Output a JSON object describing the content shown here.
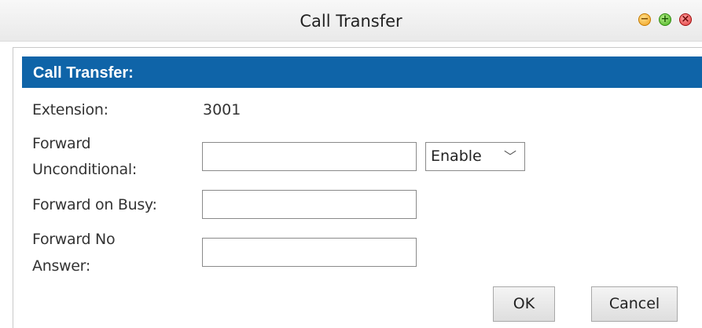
{
  "window": {
    "title": "Call Transfer"
  },
  "window_controls": {
    "minimize_glyph": "−",
    "maximize_glyph": "+",
    "close_glyph": "×"
  },
  "section": {
    "header": "Call Transfer:"
  },
  "form": {
    "extension_label": "Extension:",
    "extension_value": "3001",
    "forward_unconditional_label_line1": "Forward",
    "forward_unconditional_label_line2": "Unconditional:",
    "forward_unconditional_value": "",
    "forward_unconditional_mode": "Enable",
    "forward_busy_label": "Forward on Busy:",
    "forward_busy_value": "",
    "forward_no_answer_label_line1": "Forward No",
    "forward_no_answer_label_line2": "Answer:",
    "forward_no_answer_value": ""
  },
  "buttons": {
    "ok": "OK",
    "cancel": "Cancel"
  },
  "colors": {
    "header_bg": "#0f64a8"
  }
}
